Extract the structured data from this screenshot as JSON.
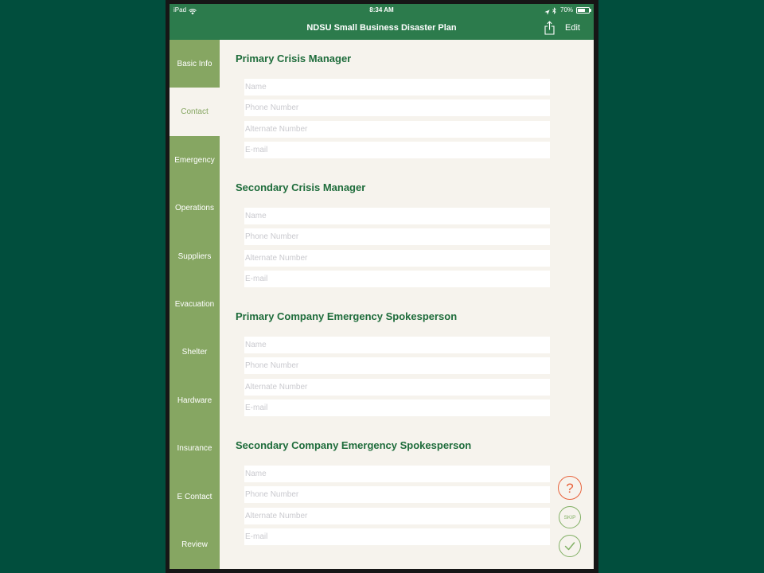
{
  "colors": {
    "page_background": "#014e3d",
    "header": "#2c7b4c",
    "sidebar": "#86a662",
    "content_background": "#f6f3ed",
    "heading": "#1e6c3b",
    "help_accent": "#e8633c",
    "action_accent": "#82b065"
  },
  "status_bar": {
    "device": "iPad",
    "time": "8:34 AM",
    "battery": "70%",
    "icons": [
      "wifi-icon",
      "location-icon",
      "bluetooth-icon",
      "battery-icon"
    ]
  },
  "nav": {
    "title": "NDSU Small Business Disaster Plan",
    "share_icon": "share-icon",
    "edit_label": "Edit"
  },
  "sidebar": {
    "active_index": 1,
    "items": [
      {
        "label": "Basic Info"
      },
      {
        "label": "Contact"
      },
      {
        "label": "Emergency"
      },
      {
        "label": "Operations"
      },
      {
        "label": "Suppliers"
      },
      {
        "label": "Evacuation"
      },
      {
        "label": "Shelter"
      },
      {
        "label": "Hardware"
      },
      {
        "label": "Insurance"
      },
      {
        "label": "E Contact"
      },
      {
        "label": "Review"
      }
    ]
  },
  "sections": [
    {
      "title": "Primary Crisis Manager",
      "fields": [
        {
          "placeholder": "Name",
          "value": ""
        },
        {
          "placeholder": "Phone Number",
          "value": ""
        },
        {
          "placeholder": "Alternate Number",
          "value": ""
        },
        {
          "placeholder": "E-mail",
          "value": ""
        }
      ]
    },
    {
      "title": "Secondary Crisis Manager",
      "fields": [
        {
          "placeholder": "Name",
          "value": ""
        },
        {
          "placeholder": "Phone Number",
          "value": ""
        },
        {
          "placeholder": "Alternate Number",
          "value": ""
        },
        {
          "placeholder": "E-mail",
          "value": ""
        }
      ]
    },
    {
      "title": "Primary Company Emergency Spokesperson",
      "fields": [
        {
          "placeholder": "Name",
          "value": ""
        },
        {
          "placeholder": "Phone Number",
          "value": ""
        },
        {
          "placeholder": "Alternate Number",
          "value": ""
        },
        {
          "placeholder": "E-mail",
          "value": ""
        }
      ]
    },
    {
      "title": "Secondary Company Emergency Spokesperson",
      "fields": [
        {
          "placeholder": "Name",
          "value": ""
        },
        {
          "placeholder": "Phone Number",
          "value": ""
        },
        {
          "placeholder": "Alternate Number",
          "value": ""
        },
        {
          "placeholder": "E-mail",
          "value": ""
        }
      ]
    }
  ],
  "actions": {
    "help_label": "?",
    "skip_label": "SKIP",
    "done_icon": "checkmark-icon"
  }
}
